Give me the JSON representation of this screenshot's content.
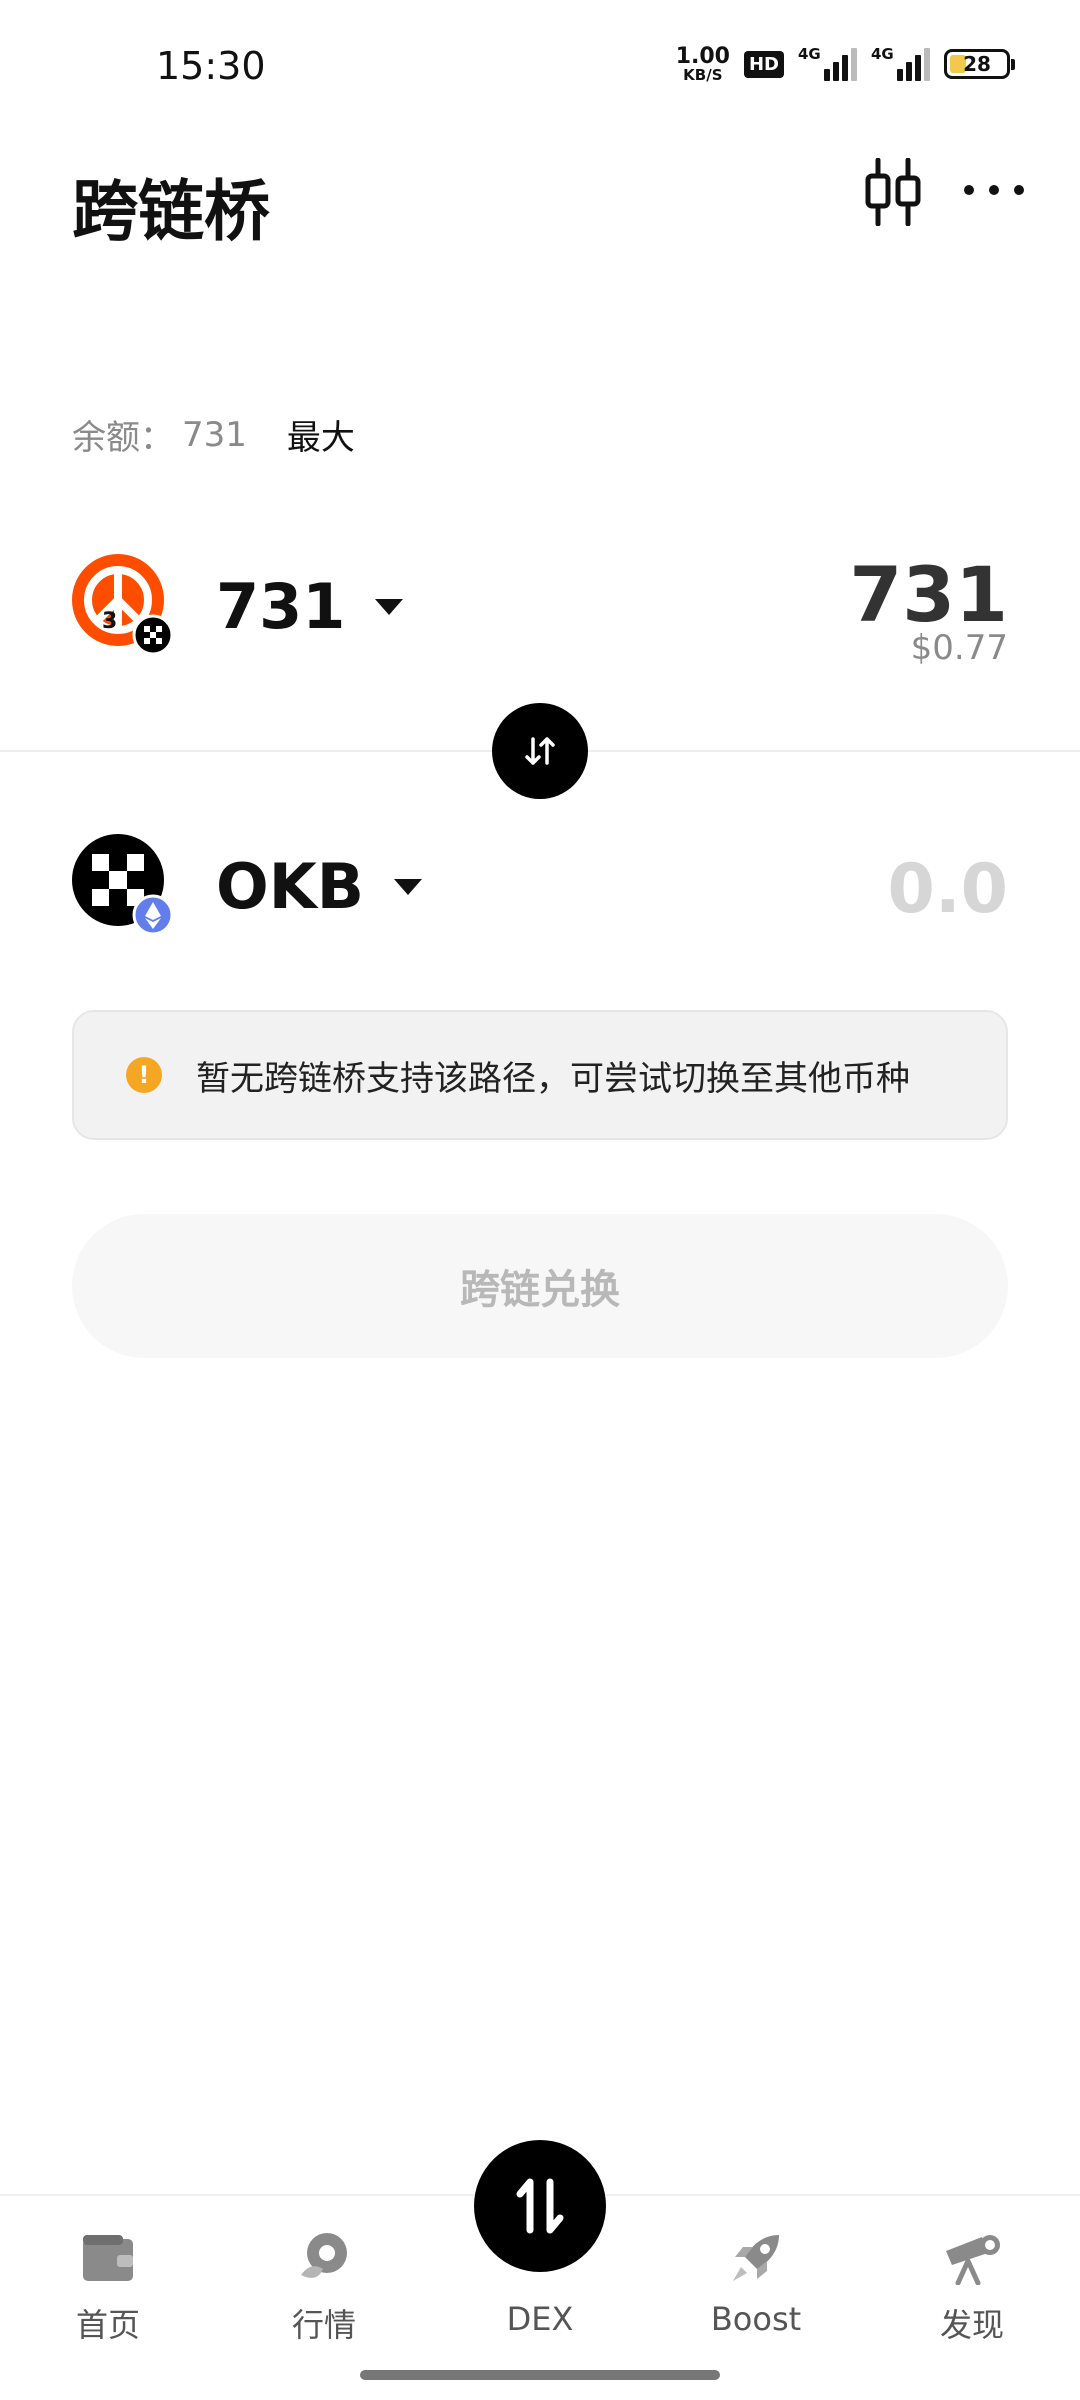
{
  "status_bar": {
    "time": "15:30",
    "net_speed_value": "1.00",
    "net_speed_unit": "KB/S",
    "hd_label": "HD",
    "signal1_label": "4G",
    "signal2_label": "4G",
    "battery_level": "28"
  },
  "header": {
    "title": "跨链桥",
    "chart_icon": "candlestick-chart-icon",
    "more_icon": "more-horizontal-icon"
  },
  "balance": {
    "label": "余额：",
    "value": "731",
    "max_label": "最大"
  },
  "from_token": {
    "symbol": "731",
    "amount": "731",
    "usd_value": "$0.77",
    "icon": "token-731-icon",
    "chain_badge": "okx-chain-badge-icon"
  },
  "to_token": {
    "symbol": "OKB",
    "amount_placeholder": "0.0",
    "icon": "okb-token-icon",
    "chain_badge": "ethereum-badge-icon"
  },
  "swap_icon": "swap-direction-icon",
  "warning": {
    "icon": "warning-icon",
    "text": "暂无跨链桥支持该路径，可尝试切换至其他币种"
  },
  "action_button": {
    "label": "跨链兑换"
  },
  "bottom_nav": {
    "items": [
      {
        "label": "首页",
        "icon": "wallet-icon"
      },
      {
        "label": "行情",
        "icon": "market-icon"
      },
      {
        "label": "DEX",
        "icon": "swap-arrows-icon"
      },
      {
        "label": "Boost",
        "icon": "rocket-icon"
      },
      {
        "label": "发现",
        "icon": "telescope-icon"
      }
    ]
  },
  "colors": {
    "primary": "#000000",
    "warning": "#f5a623",
    "muted_text": "#8a8a8a",
    "disabled_button_bg": "#f7f7f7",
    "token_731_brand": "#ff4d00",
    "ethereum_badge": "#627eea"
  }
}
